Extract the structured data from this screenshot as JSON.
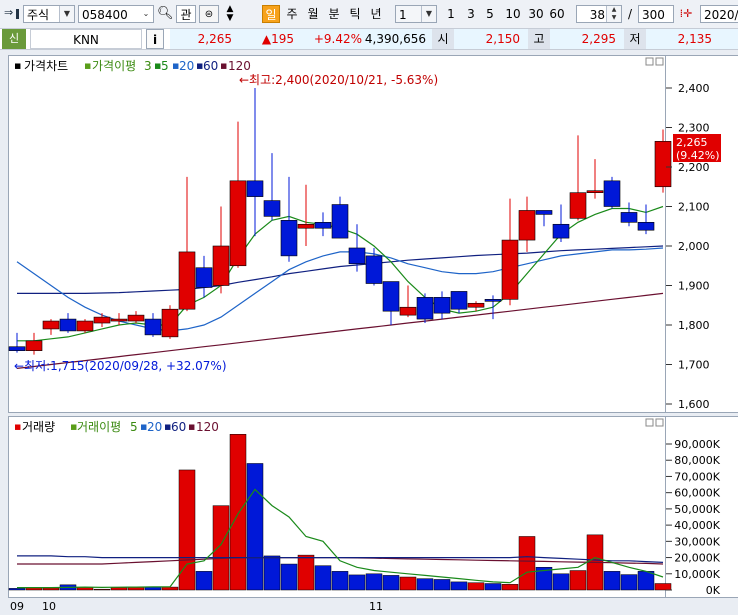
{
  "toolbar": {
    "market": "주식",
    "code": "058400",
    "fav_label": "관",
    "day_btn": "일",
    "week_btn": "주",
    "month_btn": "월",
    "minute_btn": "분",
    "tick_btn": "틱",
    "year_btn": "년",
    "period_value": "1",
    "periods": [
      "1",
      "3",
      "5",
      "10",
      "30",
      "60"
    ],
    "count_value": "38",
    "slash": "/",
    "total_value": "300",
    "date_value": "2020/"
  },
  "info": {
    "badge": "신",
    "name": "KNN",
    "info_btn": "i",
    "price": "2,265",
    "change": "▲195",
    "change_pct": "+9.42%",
    "volume": "4,390,656",
    "open_label": "시",
    "open": "2,150",
    "high_label": "고",
    "high": "2,295",
    "low_label": "저",
    "low": "2,135"
  },
  "price_panel": {
    "legend": [
      "가격차트",
      "가격이평",
      "3",
      "5",
      "20",
      "60",
      "120"
    ],
    "y_ticks": [
      "2,400",
      "2,300",
      "2,200",
      "2,100",
      "2,000",
      "1,900",
      "1,800",
      "1,700",
      "1,600"
    ],
    "current_price": "2,265",
    "current_pct": "(9.42%)",
    "high_annotation": "←최고:2,400(2020/10/21, -5.63%)",
    "low_annotation": "←최저:1,715(2020/09/28, +32.07%)"
  },
  "volume_panel": {
    "legend": [
      "거래량",
      "거래이평",
      "5",
      "20",
      "60",
      "120"
    ],
    "y_ticks": [
      "90,000K",
      "80,000K",
      "70,000K",
      "60,000K",
      "50,000K",
      "40,000K",
      "30,000K",
      "20,000K",
      "10,000K",
      "0K"
    ]
  },
  "x_axis": {
    "labels": [
      "09",
      "10",
      "11"
    ]
  },
  "colors": {
    "up": "#e00000",
    "down": "#0018d8",
    "ma3": "#5a9e1a",
    "ma5": "#1a8a1a",
    "ma20": "#1e64c8",
    "ma60": "#102080",
    "ma120": "#6a1030"
  },
  "chart_data": {
    "type": "candlestick",
    "candles": [
      {
        "o": 1745,
        "h": 1780,
        "l": 1730,
        "c": 1735
      },
      {
        "o": 1735,
        "h": 1780,
        "l": 1725,
        "c": 1760
      },
      {
        "o": 1790,
        "h": 1815,
        "l": 1775,
        "c": 1810
      },
      {
        "o": 1815,
        "h": 1830,
        "l": 1780,
        "c": 1785
      },
      {
        "o": 1785,
        "h": 1815,
        "l": 1780,
        "c": 1810
      },
      {
        "o": 1805,
        "h": 1830,
        "l": 1795,
        "c": 1820
      },
      {
        "o": 1810,
        "h": 1830,
        "l": 1800,
        "c": 1815
      },
      {
        "o": 1810,
        "h": 1835,
        "l": 1805,
        "c": 1825
      },
      {
        "o": 1815,
        "h": 1830,
        "l": 1770,
        "c": 1775
      },
      {
        "o": 1770,
        "h": 1850,
        "l": 1765,
        "c": 1840
      },
      {
        "o": 1840,
        "h": 2175,
        "l": 1835,
        "c": 1985
      },
      {
        "o": 1945,
        "h": 1975,
        "l": 1870,
        "c": 1895
      },
      {
        "o": 1900,
        "h": 2100,
        "l": 1880,
        "c": 2000
      },
      {
        "o": 1950,
        "h": 2315,
        "l": 1945,
        "c": 2165
      },
      {
        "o": 2165,
        "h": 2400,
        "l": 2025,
        "c": 2125
      },
      {
        "o": 2115,
        "h": 2235,
        "l": 2065,
        "c": 2075
      },
      {
        "o": 2065,
        "h": 2175,
        "l": 1960,
        "c": 1975
      },
      {
        "o": 2045,
        "h": 2155,
        "l": 2000,
        "c": 2055
      },
      {
        "o": 2060,
        "h": 2085,
        "l": 2025,
        "c": 2045
      },
      {
        "o": 2105,
        "h": 2125,
        "l": 2020,
        "c": 2020
      },
      {
        "o": 1995,
        "h": 2055,
        "l": 1935,
        "c": 1955
      },
      {
        "o": 1975,
        "h": 1995,
        "l": 1900,
        "c": 1905
      },
      {
        "o": 1910,
        "h": 1910,
        "l": 1800,
        "c": 1835
      },
      {
        "o": 1825,
        "h": 1900,
        "l": 1820,
        "c": 1845
      },
      {
        "o": 1870,
        "h": 1880,
        "l": 1805,
        "c": 1815
      },
      {
        "o": 1870,
        "h": 1885,
        "l": 1815,
        "c": 1830
      },
      {
        "o": 1885,
        "h": 1885,
        "l": 1830,
        "c": 1840
      },
      {
        "o": 1845,
        "h": 1860,
        "l": 1835,
        "c": 1855
      },
      {
        "o": 1865,
        "h": 1875,
        "l": 1815,
        "c": 1860
      },
      {
        "o": 1865,
        "h": 2120,
        "l": 1850,
        "c": 2015
      },
      {
        "o": 2015,
        "h": 2125,
        "l": 1985,
        "c": 2090
      },
      {
        "o": 2090,
        "h": 2085,
        "l": 2050,
        "c": 2080
      },
      {
        "o": 2055,
        "h": 2105,
        "l": 2010,
        "c": 2020
      },
      {
        "o": 2070,
        "h": 2280,
        "l": 2065,
        "c": 2135
      },
      {
        "o": 2135,
        "h": 2220,
        "l": 2120,
        "c": 2140
      },
      {
        "o": 2165,
        "h": 2175,
        "l": 2095,
        "c": 2100
      },
      {
        "o": 2085,
        "h": 2110,
        "l": 2050,
        "c": 2060
      },
      {
        "o": 2060,
        "h": 2105,
        "l": 2030,
        "c": 2040
      },
      {
        "o": 2150,
        "h": 2295,
        "l": 2135,
        "c": 2265
      }
    ],
    "volumes": [
      1000,
      1500,
      1300,
      3200,
      1700,
      500,
      1600,
      1700,
      1700,
      1800,
      74000,
      11500,
      52000,
      96000,
      78000,
      21000,
      16000,
      21500,
      15000,
      11500,
      9300,
      10000,
      9000,
      8000,
      7000,
      6500,
      5000,
      4500,
      4000,
      3500,
      33000,
      14000,
      10000,
      12000,
      34000,
      11500,
      9500,
      11500,
      4000
    ],
    "ma5_price": [
      1760,
      1760,
      1765,
      1770,
      1780,
      1790,
      1800,
      1805,
      1800,
      1800,
      1850,
      1870,
      1900,
      1970,
      2030,
      2065,
      2075,
      2060,
      2055,
      2045,
      2030,
      2000,
      1960,
      1910,
      1870,
      1840,
      1830,
      1835,
      1845,
      1880,
      1930,
      1980,
      2030,
      2060,
      2080,
      2095,
      2095,
      2085,
      2100
    ],
    "ma20_price": [
      1960,
      1930,
      1900,
      1870,
      1845,
      1825,
      1810,
      1800,
      1790,
      1785,
      1790,
      1800,
      1820,
      1850,
      1880,
      1910,
      1940,
      1960,
      1975,
      1985,
      1985,
      1980,
      1970,
      1955,
      1945,
      1935,
      1930,
      1930,
      1935,
      1945,
      1955,
      1965,
      1975,
      1980,
      1985,
      1990,
      1990,
      1992,
      1995
    ],
    "ma60_price": [
      1880,
      1880,
      1880,
      1880,
      1880,
      1881,
      1882,
      1884,
      1886,
      1888,
      1890,
      1895,
      1900,
      1908,
      1915,
      1922,
      1930,
      1936,
      1942,
      1948,
      1952,
      1956,
      1960,
      1964,
      1967,
      1970,
      1973,
      1976,
      1978,
      1980,
      1982,
      1985,
      1988,
      1990,
      1992,
      1994,
      1996,
      1998,
      2000
    ],
    "ma120_price": [
      1690,
      1695,
      1700,
      1705,
      1710,
      1715,
      1720,
      1725,
      1730,
      1735,
      1740,
      1745,
      1750,
      1755,
      1760,
      1765,
      1770,
      1775,
      1780,
      1785,
      1790,
      1795,
      1800,
      1805,
      1810,
      1815,
      1820,
      1825,
      1830,
      1835,
      1840,
      1845,
      1850,
      1855,
      1860,
      1865,
      1870,
      1875,
      1880
    ],
    "vol_ma5": [
      1500,
      1500,
      1500,
      1600,
      1800,
      1600,
      1700,
      1800,
      1900,
      1900,
      16000,
      18000,
      28000,
      47000,
      62000,
      52000,
      45000,
      33000,
      30000,
      18000,
      14000,
      12000,
      11000,
      10000,
      9000,
      8000,
      7000,
      6000,
      5000,
      4500,
      11000,
      12000,
      13000,
      14000,
      20000,
      17000,
      14000,
      11500,
      8000
    ],
    "vol_ma20": [
      21000,
      21000,
      21000,
      20500,
      20500,
      20000,
      20000,
      20000,
      20000,
      20000,
      20000,
      20000,
      20000,
      20000,
      20000,
      20000,
      20000,
      20000,
      20000,
      20000,
      20000,
      20000,
      20000,
      20000,
      20000,
      20000,
      20000,
      20000,
      20000,
      20000,
      20500,
      20000,
      19500,
      19000,
      18500,
      18000,
      18000,
      17500,
      17000
    ],
    "vol_ma60": [
      16000,
      16000,
      16000,
      16000,
      16000,
      16000,
      16500,
      17000,
      17500,
      18000,
      18500,
      19000,
      19500,
      20000,
      20000,
      20000,
      20000,
      20000,
      20000,
      20000,
      19800,
      19600,
      19400,
      19200,
      19000,
      18800,
      18600,
      18400,
      18200,
      18000,
      17800,
      17600,
      17400,
      17200,
      17000,
      16800,
      16600,
      16400,
      16000
    ],
    "y_range": [
      1580,
      2440
    ],
    "vol_range": [
      0,
      100000
    ]
  }
}
